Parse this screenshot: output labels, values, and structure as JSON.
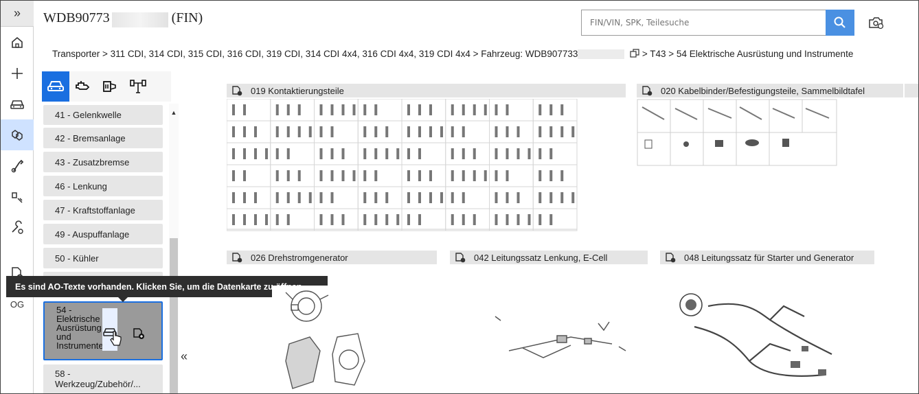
{
  "header": {
    "fin_title": "WDB90773",
    "fin_suffix": "(FIN)",
    "search_placeholder": "FIN/VIN, SPK, Teilesuche"
  },
  "rail": {
    "items": [
      {
        "icon": "collapse-icon"
      },
      {
        "icon": "home-icon"
      },
      {
        "icon": "plus-icon"
      },
      {
        "icon": "car-icon"
      },
      {
        "icon": "parts-icon"
      },
      {
        "icon": "tools-icon"
      },
      {
        "icon": "engine-icon"
      },
      {
        "icon": "repair-icon"
      },
      {
        "icon": "document-alert-icon"
      },
      {
        "label": "OG"
      }
    ]
  },
  "breadcrumb": {
    "part1": "Transporter > 311 CDI, 314 CDI, 315 CDI, 316 CDI, 319 CDI, 314 CDI 4x4, 316 CDI 4x4, 319 CDI 4x4 > Fahrzeug: WDB907733",
    "part2": " > T43  > 54 Elektrische Ausrüstung und Instrumente"
  },
  "vehicle_tabs": [
    "vehicle-icon",
    "engine-icon",
    "transmission-icon",
    "axle-icon"
  ],
  "categories": [
    "41 - Gelenkwelle",
    "42 - Bremsanlage",
    "43 - Zusatzbremse",
    "46 - Lenkung",
    "47 - Kraftstoffanlage",
    "49 - Auspuffanlage",
    "50 - Kühler",
    "54 - Elektrische Ausrüstung und Instrumente",
    "58 - Werkzeug/Zubehör/..."
  ],
  "tooltip": "Es sind AO-Texte vorhanden. Klicken Sie, um die Datenkarte zu öffnen.",
  "groups": [
    "019 Kontaktierungsteile",
    "020 Kabelbinder/Befestigungsteile, Sammelbildtafel",
    "026 Drehstromgenerator",
    "042 Leitungssatz Lenkung, E-Cell",
    "048 Leitungssatz für Starter und Generator"
  ],
  "colors": {
    "accent": "#1a6fe0",
    "search_button": "#4a90e2",
    "tooltip_bg": "#2e2e2e"
  }
}
